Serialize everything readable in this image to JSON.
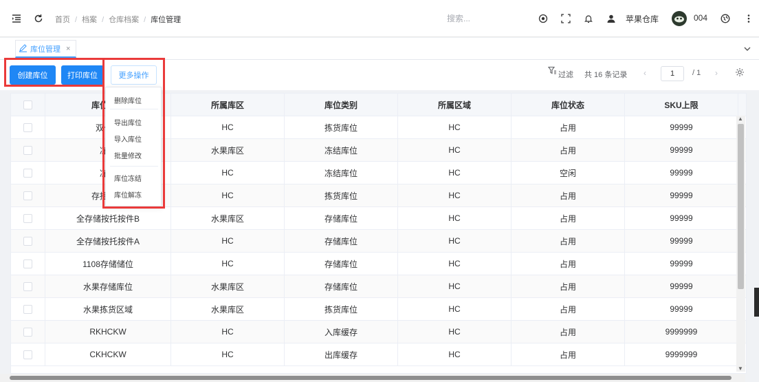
{
  "header": {
    "breadcrumb": [
      "首页",
      "档案",
      "仓库档案",
      "库位管理"
    ],
    "search_placeholder": "搜索...",
    "warehouse": "苹果仓库",
    "user": "004",
    "icons": [
      "menu-fold-icon",
      "refresh-icon",
      "record-icon",
      "fullscreen-icon",
      "bell-icon",
      "user-icon",
      "globe-icon",
      "more-vertical-icon"
    ]
  },
  "tabs": [
    {
      "label": "库位管理",
      "close": "×"
    }
  ],
  "toolbar": {
    "create_label": "创建库位",
    "print_label": "打印库位",
    "more_label": "更多操作",
    "filter_label": "过滤",
    "total_text": "共 16 条记录",
    "page_current": "1",
    "page_total": "/ 1",
    "prev": "‹",
    "next": "›"
  },
  "dropdown": {
    "items": [
      "删除库位",
      "导出库位",
      "导入库位",
      "批量修改",
      "库位冻结",
      "库位解冻"
    ]
  },
  "table": {
    "columns": [
      "库位名称",
      "所属库区",
      "库位类别",
      "所属区域",
      "库位状态",
      "SKU上限"
    ],
    "rows": [
      [
        "双十一",
        "HC",
        "拣货库位",
        "HC",
        "占用",
        "99999"
      ],
      [
        "冻结",
        "水果库区",
        "冻结库位",
        "HC",
        "占用",
        "99999"
      ],
      [
        "冻结",
        "HC",
        "冻结库位",
        "HC",
        "空闲",
        "99999"
      ],
      [
        "存拣分配",
        "HC",
        "拣货库位",
        "HC",
        "占用",
        "99999"
      ],
      [
        "全存储按托按件B",
        "水果库区",
        "存储库位",
        "HC",
        "占用",
        "99999"
      ],
      [
        "全存储按托按件A",
        "HC",
        "存储库位",
        "HC",
        "占用",
        "99999"
      ],
      [
        "1108存储储位",
        "HC",
        "存储库位",
        "HC",
        "占用",
        "99999"
      ],
      [
        "水果存储库位",
        "水果库区",
        "存储库位",
        "HC",
        "占用",
        "99999"
      ],
      [
        "水果拣货区域",
        "水果库区",
        "拣货库位",
        "HC",
        "占用",
        "99999"
      ],
      [
        "RKHCKW",
        "HC",
        "入库缓存",
        "HC",
        "占用",
        "9999999"
      ],
      [
        "CKHCKW",
        "HC",
        "出库缓存",
        "HC",
        "占用",
        "9999999"
      ]
    ]
  },
  "colors": {
    "primary": "#1f87f5",
    "highlight": "#ea3a3a"
  }
}
